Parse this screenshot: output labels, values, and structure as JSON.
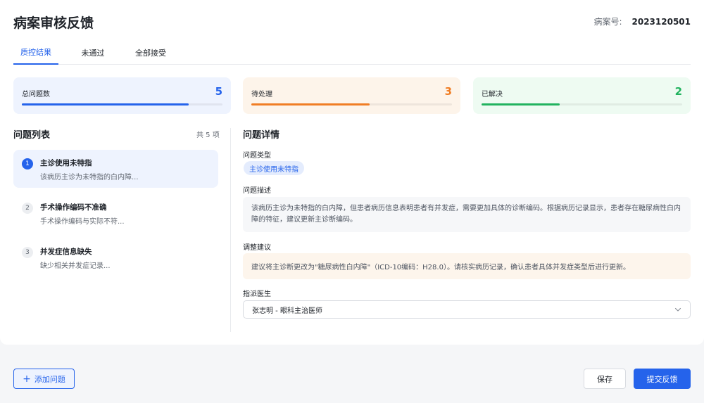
{
  "header": {
    "title": "病案审核反馈",
    "case_label": "病案号:",
    "case_number": "2023120501"
  },
  "tabs": [
    {
      "label": "质控结果",
      "active": true
    },
    {
      "label": "未通过",
      "active": false
    },
    {
      "label": "全部接受",
      "active": false
    }
  ],
  "stats": [
    {
      "label": "总问题数",
      "value": "5",
      "progress": 0.83,
      "color": "#2563eb",
      "bg": "#eef3fe"
    },
    {
      "label": "待处理",
      "value": "3",
      "progress": 0.59,
      "color": "#f07d24",
      "bg": "#fdf4ea"
    },
    {
      "label": "已解决",
      "value": "2",
      "progress": 0.39,
      "color": "#22b35f",
      "bg": "#eefbf2"
    }
  ],
  "issue_list": {
    "title": "问题列表",
    "count": "共 5 项",
    "items": [
      {
        "num": "1",
        "title": "主诊使用未特指",
        "desc": "该病历主诊为未特指的白内障...",
        "active": true
      },
      {
        "num": "2",
        "title": "手术操作编码不准确",
        "desc": "手术操作编码与实际不符...",
        "active": false
      },
      {
        "num": "3",
        "title": "并发症信息缺失",
        "desc": "缺少相关并发症记录...",
        "active": false
      }
    ]
  },
  "detail": {
    "title": "问题详情",
    "type_label": "问题类型",
    "type_tag": "主诊使用未特指",
    "desc_label": "问题描述",
    "desc_text": "该病历主诊为未特指的白内障，但患者病历信息表明患者有并发症，需要更加具体的诊断编码。根据病历记录显示，患者存在糖尿病性白内障的特征，建议更新主诊断编码。",
    "suggestion_label": "调整建议",
    "suggestion_text": "建议将主诊断更改为\"糖尿病性白内障\"（ICD-10编码：H28.0）。请核实病历记录，确认患者具体并发症类型后进行更新。",
    "doctor_label": "指派医生",
    "doctor_value": "张志明 - 眼科主治医师"
  },
  "footer": {
    "add_label": "添加问题",
    "save_label": "保存",
    "submit_label": "提交反馈"
  },
  "icons": {
    "add": "plus-icon",
    "select": "chevron-down-icon"
  }
}
